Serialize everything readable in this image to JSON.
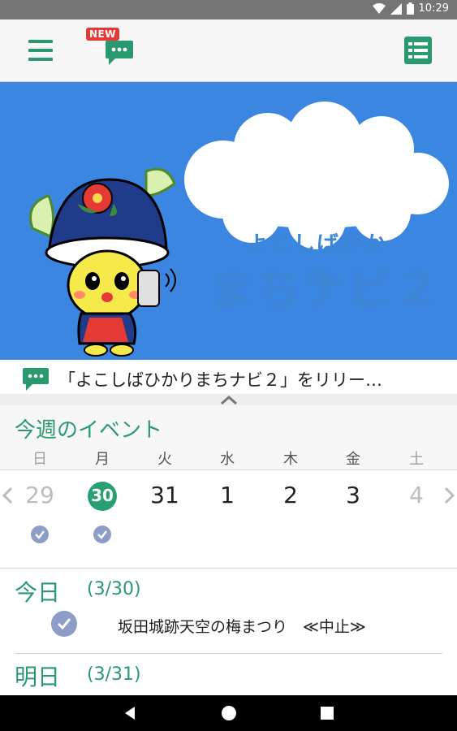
{
  "status_bar": {
    "time": "10:29"
  },
  "toolbar": {
    "new_badge": "NEW"
  },
  "banner": {
    "subtitle": "よこしばひかり",
    "title": "まちナビ２",
    "colors": {
      "background": "#3a86e0",
      "text": "#3f85d6"
    }
  },
  "news": {
    "text": "「よこしばひかりまちナビ２」をリリー…"
  },
  "week": {
    "title": "今週のイベント",
    "days": [
      {
        "dow": "日",
        "date": "29",
        "checked": true
      },
      {
        "dow": "月",
        "date": "30",
        "checked": true,
        "today": true
      },
      {
        "dow": "火",
        "date": "31",
        "checked": false
      },
      {
        "dow": "水",
        "date": "1",
        "checked": false
      },
      {
        "dow": "木",
        "date": "2",
        "checked": false
      },
      {
        "dow": "金",
        "date": "3",
        "checked": false
      },
      {
        "dow": "土",
        "date": "4",
        "checked": false
      }
    ]
  },
  "events": {
    "today": {
      "label": "今日",
      "date": "(3/30)",
      "item": "坂田城跡天空の梅まつり　≪中止≫"
    },
    "tomorrow": {
      "label": "明日",
      "date": "(3/31)"
    }
  },
  "colors": {
    "accent": "#2a9a6e",
    "check": "#8e9cc8",
    "badge": "#e53935"
  }
}
